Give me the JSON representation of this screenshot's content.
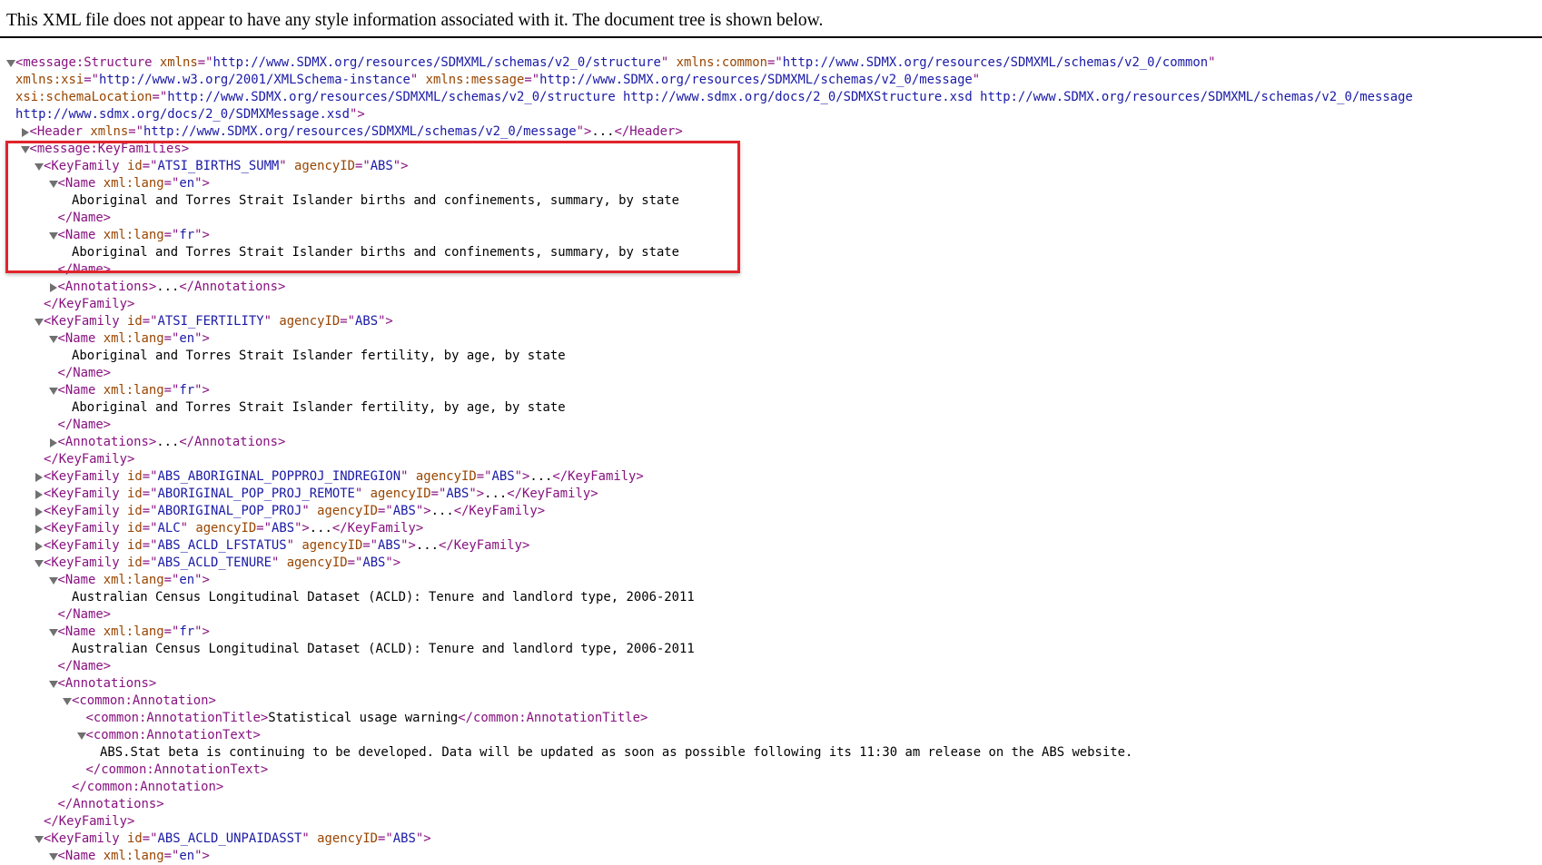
{
  "banner": {
    "text": "This XML file does not appear to have any style information associated with it. The document tree is shown below."
  },
  "tree_lines": [
    {
      "indent": 0,
      "toggle": "open",
      "parts": [
        [
          "t",
          "<message:Structure"
        ],
        [
          "s",
          " "
        ],
        [
          "an",
          "xmlns"
        ],
        [
          "t",
          "=\""
        ],
        [
          "av",
          "http://www.SDMX.org/resources/SDMXML/schemas/v2_0/structure"
        ],
        [
          "t",
          "\""
        ],
        [
          "s",
          " "
        ],
        [
          "an",
          "xmlns:common"
        ],
        [
          "t",
          "=\""
        ],
        [
          "av",
          "http://www.SDMX.org/resources/SDMXML/schemas/v2_0/common"
        ],
        [
          "t",
          "\""
        ]
      ]
    },
    {
      "indent": 0,
      "toggle": "none",
      "parts": [
        [
          "an",
          "xmlns:xsi"
        ],
        [
          "t",
          "=\""
        ],
        [
          "av",
          "http://www.w3.org/2001/XMLSchema-instance"
        ],
        [
          "t",
          "\""
        ],
        [
          "s",
          " "
        ],
        [
          "an",
          "xmlns:message"
        ],
        [
          "t",
          "=\""
        ],
        [
          "av",
          "http://www.SDMX.org/resources/SDMXML/schemas/v2_0/message"
        ],
        [
          "t",
          "\""
        ]
      ]
    },
    {
      "indent": 0,
      "toggle": "none",
      "parts": [
        [
          "an",
          "xsi:schemaLocation"
        ],
        [
          "t",
          "=\""
        ],
        [
          "av",
          "http://www.SDMX.org/resources/SDMXML/schemas/v2_0/structure http://www.sdmx.org/docs/2_0/SDMXStructure.xsd http://www.SDMX.org/resources/SDMXML/schemas/v2_0/message"
        ]
      ]
    },
    {
      "indent": 0,
      "toggle": "none",
      "parts": [
        [
          "av",
          "http://www.sdmx.org/docs/2_0/SDMXMessage.xsd"
        ],
        [
          "t",
          "\">"
        ]
      ]
    },
    {
      "indent": 1,
      "toggle": "closed",
      "parts": [
        [
          "t",
          "<Header"
        ],
        [
          "s",
          " "
        ],
        [
          "an",
          "xmlns"
        ],
        [
          "t",
          "=\""
        ],
        [
          "av",
          "http://www.SDMX.org/resources/SDMXML/schemas/v2_0/message"
        ],
        [
          "t",
          "\">"
        ],
        [
          "s",
          "..."
        ],
        [
          "t",
          "</Header>"
        ]
      ]
    },
    {
      "indent": 1,
      "toggle": "open",
      "parts": [
        [
          "t",
          "<message:KeyFamilies>"
        ]
      ]
    },
    {
      "indent": 2,
      "toggle": "open",
      "parts": [
        [
          "t",
          "<KeyFamily"
        ],
        [
          "s",
          " "
        ],
        [
          "an",
          "id"
        ],
        [
          "t",
          "=\""
        ],
        [
          "av",
          "ATSI_BIRTHS_SUMM"
        ],
        [
          "t",
          "\""
        ],
        [
          "s",
          " "
        ],
        [
          "an",
          "agencyID"
        ],
        [
          "t",
          "=\""
        ],
        [
          "av",
          "ABS"
        ],
        [
          "t",
          "\">"
        ]
      ]
    },
    {
      "indent": 3,
      "toggle": "open",
      "parts": [
        [
          "t",
          "<Name"
        ],
        [
          "s",
          " "
        ],
        [
          "an",
          "xml:lang"
        ],
        [
          "t",
          "=\""
        ],
        [
          "av",
          "en"
        ],
        [
          "t",
          "\">"
        ]
      ]
    },
    {
      "indent": 4,
      "toggle": "none",
      "parts": [
        [
          "s",
          "Aboriginal and Torres Strait Islander births and confinements, summary, by state"
        ]
      ]
    },
    {
      "indent": 3,
      "toggle": "none",
      "parts": [
        [
          "t",
          "</Name>"
        ]
      ]
    },
    {
      "indent": 3,
      "toggle": "open",
      "parts": [
        [
          "t",
          "<Name"
        ],
        [
          "s",
          " "
        ],
        [
          "an",
          "xml:lang"
        ],
        [
          "t",
          "=\""
        ],
        [
          "av",
          "fr"
        ],
        [
          "t",
          "\">"
        ]
      ]
    },
    {
      "indent": 4,
      "toggle": "none",
      "parts": [
        [
          "s",
          "Aboriginal and Torres Strait Islander births and confinements, summary, by state"
        ]
      ]
    },
    {
      "indent": 3,
      "toggle": "none",
      "parts": [
        [
          "t",
          "</Name>"
        ]
      ]
    },
    {
      "indent": 3,
      "toggle": "closed",
      "parts": [
        [
          "t",
          "<Annotations>"
        ],
        [
          "s",
          "..."
        ],
        [
          "t",
          "</Annotations>"
        ]
      ]
    },
    {
      "indent": 2,
      "toggle": "none",
      "parts": [
        [
          "t",
          "</KeyFamily>"
        ]
      ]
    },
    {
      "indent": 2,
      "toggle": "open",
      "parts": [
        [
          "t",
          "<KeyFamily"
        ],
        [
          "s",
          " "
        ],
        [
          "an",
          "id"
        ],
        [
          "t",
          "=\""
        ],
        [
          "av",
          "ATSI_FERTILITY"
        ],
        [
          "t",
          "\""
        ],
        [
          "s",
          " "
        ],
        [
          "an",
          "agencyID"
        ],
        [
          "t",
          "=\""
        ],
        [
          "av",
          "ABS"
        ],
        [
          "t",
          "\">"
        ]
      ]
    },
    {
      "indent": 3,
      "toggle": "open",
      "parts": [
        [
          "t",
          "<Name"
        ],
        [
          "s",
          " "
        ],
        [
          "an",
          "xml:lang"
        ],
        [
          "t",
          "=\""
        ],
        [
          "av",
          "en"
        ],
        [
          "t",
          "\">"
        ]
      ]
    },
    {
      "indent": 4,
      "toggle": "none",
      "parts": [
        [
          "s",
          "Aboriginal and Torres Strait Islander fertility, by age, by state"
        ]
      ]
    },
    {
      "indent": 3,
      "toggle": "none",
      "parts": [
        [
          "t",
          "</Name>"
        ]
      ]
    },
    {
      "indent": 3,
      "toggle": "open",
      "parts": [
        [
          "t",
          "<Name"
        ],
        [
          "s",
          " "
        ],
        [
          "an",
          "xml:lang"
        ],
        [
          "t",
          "=\""
        ],
        [
          "av",
          "fr"
        ],
        [
          "t",
          "\">"
        ]
      ]
    },
    {
      "indent": 4,
      "toggle": "none",
      "parts": [
        [
          "s",
          "Aboriginal and Torres Strait Islander fertility, by age, by state"
        ]
      ]
    },
    {
      "indent": 3,
      "toggle": "none",
      "parts": [
        [
          "t",
          "</Name>"
        ]
      ]
    },
    {
      "indent": 3,
      "toggle": "closed",
      "parts": [
        [
          "t",
          "<Annotations>"
        ],
        [
          "s",
          "..."
        ],
        [
          "t",
          "</Annotations>"
        ]
      ]
    },
    {
      "indent": 2,
      "toggle": "none",
      "parts": [
        [
          "t",
          "</KeyFamily>"
        ]
      ]
    },
    {
      "indent": 2,
      "toggle": "closed",
      "parts": [
        [
          "t",
          "<KeyFamily"
        ],
        [
          "s",
          " "
        ],
        [
          "an",
          "id"
        ],
        [
          "t",
          "=\""
        ],
        [
          "av",
          "ABS_ABORIGINAL_POPPROJ_INDREGION"
        ],
        [
          "t",
          "\""
        ],
        [
          "s",
          " "
        ],
        [
          "an",
          "agencyID"
        ],
        [
          "t",
          "=\""
        ],
        [
          "av",
          "ABS"
        ],
        [
          "t",
          "\">"
        ],
        [
          "s",
          "..."
        ],
        [
          "t",
          "</KeyFamily>"
        ]
      ]
    },
    {
      "indent": 2,
      "toggle": "closed",
      "parts": [
        [
          "t",
          "<KeyFamily"
        ],
        [
          "s",
          " "
        ],
        [
          "an",
          "id"
        ],
        [
          "t",
          "=\""
        ],
        [
          "av",
          "ABORIGINAL_POP_PROJ_REMOTE"
        ],
        [
          "t",
          "\""
        ],
        [
          "s",
          " "
        ],
        [
          "an",
          "agencyID"
        ],
        [
          "t",
          "=\""
        ],
        [
          "av",
          "ABS"
        ],
        [
          "t",
          "\">"
        ],
        [
          "s",
          "..."
        ],
        [
          "t",
          "</KeyFamily>"
        ]
      ]
    },
    {
      "indent": 2,
      "toggle": "closed",
      "parts": [
        [
          "t",
          "<KeyFamily"
        ],
        [
          "s",
          " "
        ],
        [
          "an",
          "id"
        ],
        [
          "t",
          "=\""
        ],
        [
          "av",
          "ABORIGINAL_POP_PROJ"
        ],
        [
          "t",
          "\""
        ],
        [
          "s",
          " "
        ],
        [
          "an",
          "agencyID"
        ],
        [
          "t",
          "=\""
        ],
        [
          "av",
          "ABS"
        ],
        [
          "t",
          "\">"
        ],
        [
          "s",
          "..."
        ],
        [
          "t",
          "</KeyFamily>"
        ]
      ]
    },
    {
      "indent": 2,
      "toggle": "closed",
      "parts": [
        [
          "t",
          "<KeyFamily"
        ],
        [
          "s",
          " "
        ],
        [
          "an",
          "id"
        ],
        [
          "t",
          "=\""
        ],
        [
          "av",
          "ALC"
        ],
        [
          "t",
          "\""
        ],
        [
          "s",
          " "
        ],
        [
          "an",
          "agencyID"
        ],
        [
          "t",
          "=\""
        ],
        [
          "av",
          "ABS"
        ],
        [
          "t",
          "\">"
        ],
        [
          "s",
          "..."
        ],
        [
          "t",
          "</KeyFamily>"
        ]
      ]
    },
    {
      "indent": 2,
      "toggle": "closed",
      "parts": [
        [
          "t",
          "<KeyFamily"
        ],
        [
          "s",
          " "
        ],
        [
          "an",
          "id"
        ],
        [
          "t",
          "=\""
        ],
        [
          "av",
          "ABS_ACLD_LFSTATUS"
        ],
        [
          "t",
          "\""
        ],
        [
          "s",
          " "
        ],
        [
          "an",
          "agencyID"
        ],
        [
          "t",
          "=\""
        ],
        [
          "av",
          "ABS"
        ],
        [
          "t",
          "\">"
        ],
        [
          "s",
          "..."
        ],
        [
          "t",
          "</KeyFamily>"
        ]
      ]
    },
    {
      "indent": 2,
      "toggle": "open",
      "parts": [
        [
          "t",
          "<KeyFamily"
        ],
        [
          "s",
          " "
        ],
        [
          "an",
          "id"
        ],
        [
          "t",
          "=\""
        ],
        [
          "av",
          "ABS_ACLD_TENURE"
        ],
        [
          "t",
          "\""
        ],
        [
          "s",
          " "
        ],
        [
          "an",
          "agencyID"
        ],
        [
          "t",
          "=\""
        ],
        [
          "av",
          "ABS"
        ],
        [
          "t",
          "\">"
        ]
      ]
    },
    {
      "indent": 3,
      "toggle": "open",
      "parts": [
        [
          "t",
          "<Name"
        ],
        [
          "s",
          " "
        ],
        [
          "an",
          "xml:lang"
        ],
        [
          "t",
          "=\""
        ],
        [
          "av",
          "en"
        ],
        [
          "t",
          "\">"
        ]
      ]
    },
    {
      "indent": 4,
      "toggle": "none",
      "parts": [
        [
          "s",
          "Australian Census Longitudinal Dataset (ACLD): Tenure and landlord type, 2006-2011"
        ]
      ]
    },
    {
      "indent": 3,
      "toggle": "none",
      "parts": [
        [
          "t",
          "</Name>"
        ]
      ]
    },
    {
      "indent": 3,
      "toggle": "open",
      "parts": [
        [
          "t",
          "<Name"
        ],
        [
          "s",
          " "
        ],
        [
          "an",
          "xml:lang"
        ],
        [
          "t",
          "=\""
        ],
        [
          "av",
          "fr"
        ],
        [
          "t",
          "\">"
        ]
      ]
    },
    {
      "indent": 4,
      "toggle": "none",
      "parts": [
        [
          "s",
          "Australian Census Longitudinal Dataset (ACLD): Tenure and landlord type, 2006-2011"
        ]
      ]
    },
    {
      "indent": 3,
      "toggle": "none",
      "parts": [
        [
          "t",
          "</Name>"
        ]
      ]
    },
    {
      "indent": 3,
      "toggle": "open",
      "parts": [
        [
          "t",
          "<Annotations>"
        ]
      ]
    },
    {
      "indent": 4,
      "toggle": "open",
      "parts": [
        [
          "t",
          "<common:Annotation>"
        ]
      ]
    },
    {
      "indent": 5,
      "toggle": "none",
      "parts": [
        [
          "t",
          "<common:AnnotationTitle>"
        ],
        [
          "s",
          "Statistical usage warning"
        ],
        [
          "t",
          "</common:AnnotationTitle>"
        ]
      ]
    },
    {
      "indent": 5,
      "toggle": "open",
      "parts": [
        [
          "t",
          "<common:AnnotationText>"
        ]
      ]
    },
    {
      "indent": 6,
      "toggle": "none",
      "parts": [
        [
          "s",
          "ABS.Stat beta is continuing to be developed. Data will be updated as soon as possible following its 11:30 am release on the ABS website."
        ]
      ]
    },
    {
      "indent": 5,
      "toggle": "none",
      "parts": [
        [
          "t",
          "</common:AnnotationText>"
        ]
      ]
    },
    {
      "indent": 4,
      "toggle": "none",
      "parts": [
        [
          "t",
          "</common:Annotation>"
        ]
      ]
    },
    {
      "indent": 3,
      "toggle": "none",
      "parts": [
        [
          "t",
          "</Annotations>"
        ]
      ]
    },
    {
      "indent": 2,
      "toggle": "none",
      "parts": [
        [
          "t",
          "</KeyFamily>"
        ]
      ]
    },
    {
      "indent": 2,
      "toggle": "open",
      "parts": [
        [
          "t",
          "<KeyFamily"
        ],
        [
          "s",
          " "
        ],
        [
          "an",
          "id"
        ],
        [
          "t",
          "=\""
        ],
        [
          "av",
          "ABS_ACLD_UNPAIDASST"
        ],
        [
          "t",
          "\""
        ],
        [
          "s",
          " "
        ],
        [
          "an",
          "agencyID"
        ],
        [
          "t",
          "=\""
        ],
        [
          "av",
          "ABS"
        ],
        [
          "t",
          "\">"
        ]
      ]
    },
    {
      "indent": 3,
      "toggle": "open",
      "parts": [
        [
          "t",
          "<Name"
        ],
        [
          "s",
          " "
        ],
        [
          "an",
          "xml:lang"
        ],
        [
          "t",
          "=\""
        ],
        [
          "av",
          "en"
        ],
        [
          "t",
          "\">"
        ]
      ]
    }
  ],
  "colors": {
    "tag": "#881280",
    "attr_name": "#994500",
    "attr_value": "#1a1aa6",
    "highlight_border": "#e1242c",
    "toggle_arrow": "#707070"
  }
}
